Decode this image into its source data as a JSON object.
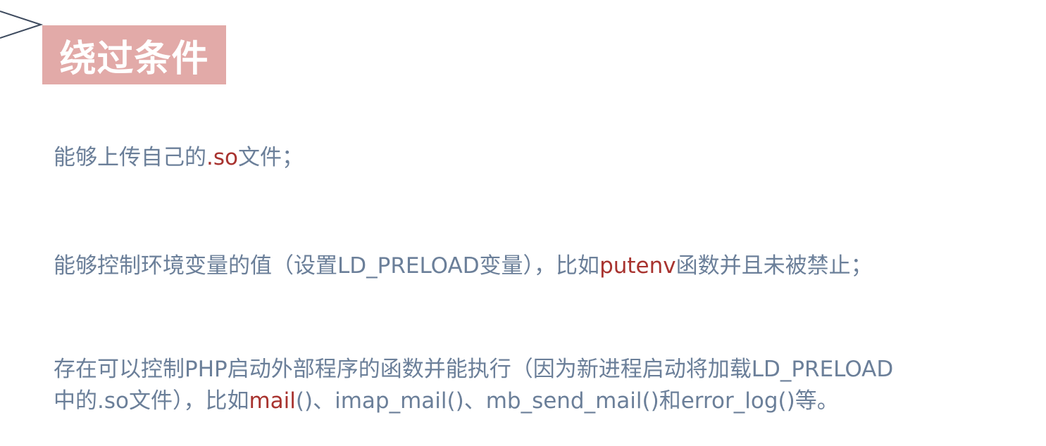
{
  "colors": {
    "title_bg": "#e2aaa8",
    "title_text": "#ffffff",
    "body_text": "#6b7f99",
    "highlight": "#a8332f",
    "arrow": "#3d4a5e"
  },
  "icons": {
    "corner": "chevron-right-icon"
  },
  "slide": {
    "title": "绕过条件",
    "items": [
      {
        "seg1": "能够上传自己的",
        "hl1": ".so",
        "seg2": "文件；"
      },
      {
        "seg1": "能够控制环境变量的值（设置LD_PRELOAD变量），比如",
        "hl1": "putenv",
        "seg2": "函数并且未被禁止；"
      },
      {
        "line1": "存在可以控制PHP启动外部程序的函数并能执行（因为新进程启动将加载LD_PRELOAD",
        "seg1": "中的.so文件），比如",
        "hl1": "mail",
        "seg2": "()、imap_mail()、mb_send_mail()和error_log()等。"
      }
    ]
  }
}
